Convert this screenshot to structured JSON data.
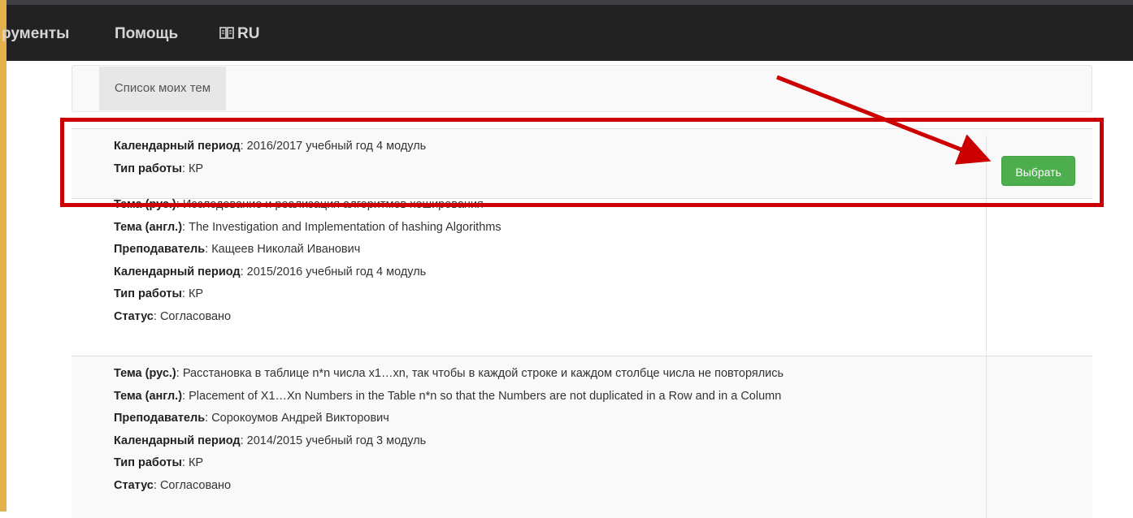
{
  "navbar": {
    "items": [
      {
        "label": "рументы"
      },
      {
        "label": "Помощь"
      },
      {
        "label": "RU",
        "icon": "language-book-icon"
      }
    ]
  },
  "tabs": [
    {
      "label": "Список моих тем",
      "active": true
    }
  ],
  "labels": {
    "topic_ru": "Тема (рус.)",
    "topic_en": "Тема (англ.)",
    "teacher": "Преподаватель",
    "period": "Календарный период",
    "work_type": "Тип работы",
    "status": "Статус"
  },
  "topics": [
    {
      "period": "2016/2017 учебный год 4 модуль",
      "work_type": "КР",
      "action_label": "Выбрать"
    },
    {
      "topic_ru": "Исследование и реализация алгоритмов хеширования",
      "topic_en": "The Investigation and Implementation of hashing Algorithms",
      "teacher": "Кащеев Николай Иванович",
      "period": "2015/2016 учебный год 4 модуль",
      "work_type": "КР",
      "status": "Согласовано"
    },
    {
      "topic_ru": "Расстановка в таблице n*n числа x1…xn, так чтобы в каждой строке и каждом столбце числа не повторялись",
      "topic_en": "Placement of X1…Xn Numbers in the Table n*n so that the Numbers are not duplicated in a Row and in a Column",
      "teacher": "Сорокоумов Андрей Викторович",
      "period": "2014/2015 учебный год 3 модуль",
      "work_type": "КР",
      "status": "Согласовано"
    }
  ],
  "colors": {
    "navbar_bg": "#222222",
    "accent_button": "#4cae4c",
    "annotation_red": "#cc0000"
  }
}
